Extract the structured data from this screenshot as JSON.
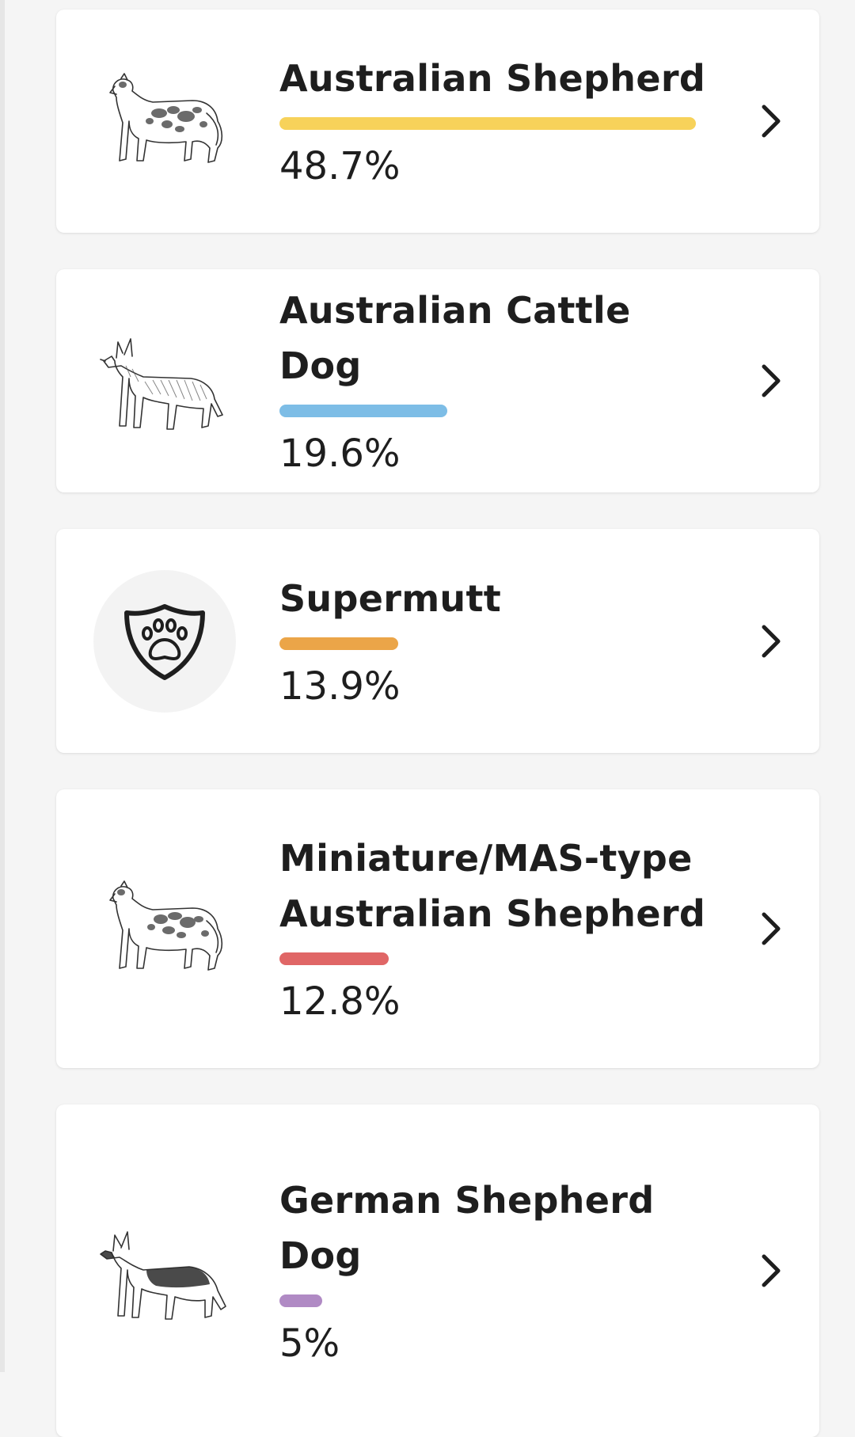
{
  "breeds": [
    {
      "name": "Australian Shepherd",
      "percent_label": "48.7%",
      "percent_value": 48.7,
      "bar_color": "#f7d25a",
      "icon": "australian-shepherd-sketch-icon"
    },
    {
      "name": "Australian Cattle Dog",
      "percent_label": "19.6%",
      "percent_value": 19.6,
      "bar_color": "#7dbde6",
      "icon": "australian-cattle-dog-sketch-icon"
    },
    {
      "name": "Supermutt",
      "percent_label": "13.9%",
      "percent_value": 13.9,
      "bar_color": "#eba548",
      "icon": "paw-shield-icon"
    },
    {
      "name": "Miniature/MAS-type Australian Shepherd",
      "name_line1": "Miniature/MAS-type",
      "name_line2": "Australian Shepherd",
      "percent_label": "12.8%",
      "percent_value": 12.8,
      "bar_color": "#e06666",
      "icon": "miniature-australian-shepherd-sketch-icon"
    },
    {
      "name": "German Shepherd Dog",
      "name_line1": "German Shepherd",
      "name_line2": "Dog",
      "percent_label": "5%",
      "percent_value": 5,
      "bar_color": "#b08ac4",
      "icon": "german-shepherd-sketch-icon"
    }
  ],
  "chevron_icon": "chevron-right-icon"
}
